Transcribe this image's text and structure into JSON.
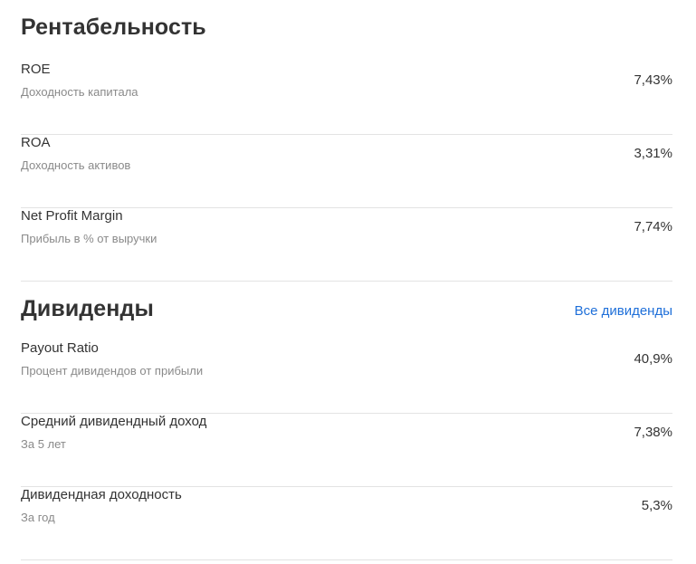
{
  "profitability": {
    "title": "Рентабельность",
    "rows": [
      {
        "label": "ROE",
        "sub": "Доходность капитала",
        "value": "7,43%"
      },
      {
        "label": "ROA",
        "sub": "Доходность активов",
        "value": "3,31%"
      },
      {
        "label": "Net Profit Margin",
        "sub": "Прибыль в % от выручки",
        "value": "7,74%"
      }
    ]
  },
  "dividends": {
    "title": "Дивиденды",
    "link": "Все дивиденды",
    "link_color": "#1e6fd9",
    "rows": [
      {
        "label": "Payout Ratio",
        "sub": "Процент дивидендов от прибыли",
        "value": "40,9%"
      },
      {
        "label": "Средний дивидендный доход",
        "sub": "За 5 лет",
        "value": "7,38%"
      },
      {
        "label": "Дивидендная доходность",
        "sub": "За год",
        "value": "5,3%"
      }
    ]
  }
}
